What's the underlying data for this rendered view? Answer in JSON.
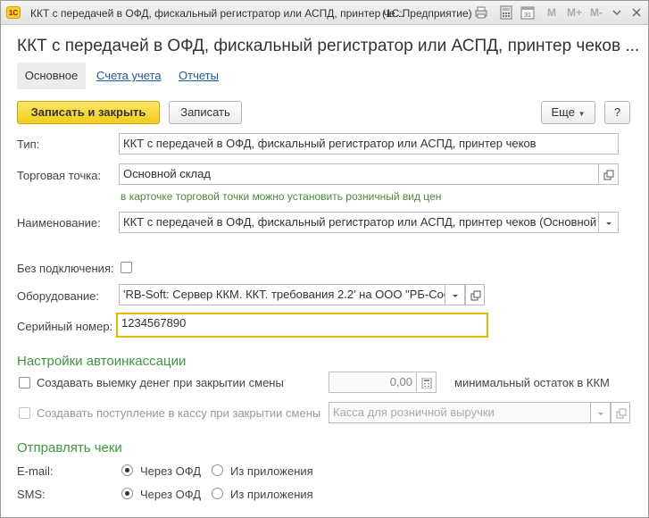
{
  "titlebar": {
    "title": "ККТ с передачей в ОФД, фискальный регистратор или АСПД, принтер че...",
    "app_name": "(1С:Предприятие)",
    "m_label": "M",
    "m_plus_label": "M+",
    "m_minus_label": "M-",
    "calendar_day": "31",
    "logo_text": "1С"
  },
  "heading": "ККТ с передачей в ОФД, фискальный регистратор или АСПД, принтер чеков ...",
  "tabs": [
    {
      "label": "Основное"
    },
    {
      "label": "Счета учета"
    },
    {
      "label": "Отчеты"
    }
  ],
  "toolbar": {
    "save_close": "Записать и закрыть",
    "save": "Записать",
    "more": "Еще",
    "help": "?"
  },
  "form": {
    "type_label": "Тип:",
    "type_value": "ККТ с передачей в ОФД, фискальный регистратор или АСПД, принтер чеков",
    "store_label": "Торговая точка:",
    "store_value": "Основной склад",
    "store_hint": "в карточке торговой точки можно установить розничный вид цен",
    "name_label": "Наименование:",
    "name_value": "ККТ с передачей в ОФД, фискальный регистратор или АСПД, принтер чеков (Основной",
    "offline_label": "Без подключения:",
    "equipment_label": "Оборудование:",
    "equipment_value": "'RB-Soft: Сервер ККМ. ККТ. требования 2.2' на ООО \"РБ-Софт\"",
    "serial_label": "Серийный номер:",
    "serial_value": "1234567890"
  },
  "collection": {
    "title": "Настройки автоинкассации",
    "withdraw_label": "Создавать выемку денег при закрытии смены",
    "min_amount": "0,00",
    "min_amount_label": "минимальный остаток в ККМ",
    "deposit_label": "Создавать поступление в кассу при закрытии смены",
    "cashbox_placeholder": "Касса для розничной выручки"
  },
  "send": {
    "title": "Отправлять чеки",
    "email_label": "E-mail:",
    "sms_label": "SMS:",
    "via_ofd": "Через ОФД",
    "from_app": "Из приложения",
    "email_selected": "Через ОФД",
    "sms_selected": "Через ОФД"
  },
  "colors": {
    "accent_yellow": "#f2cd1b",
    "section_green": "#3a9a3a",
    "link_blue": "#1a5aa3",
    "focus_border": "#e6b800"
  }
}
